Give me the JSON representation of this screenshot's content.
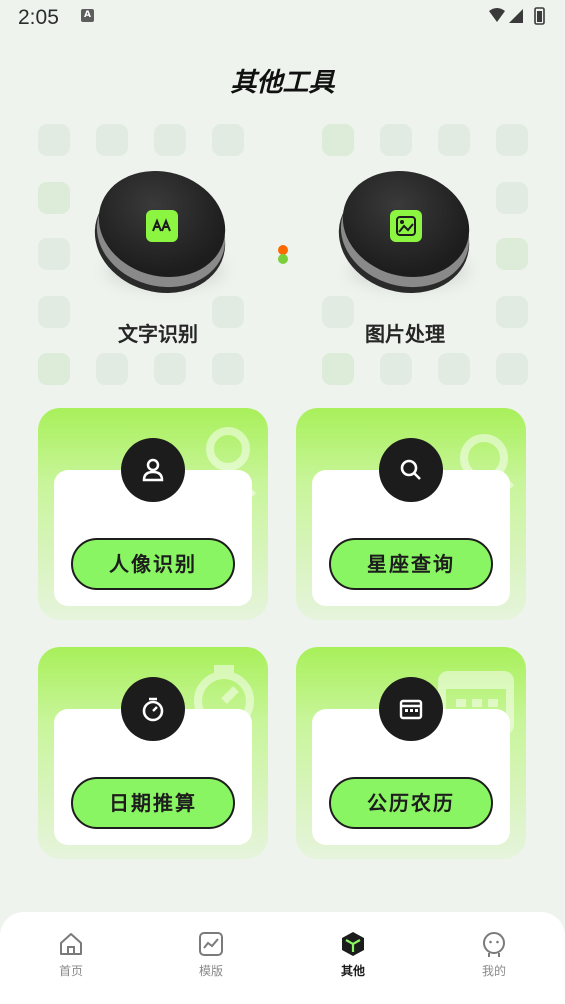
{
  "status_bar": {
    "time": "2:05",
    "notification_letter": "A"
  },
  "page_title": "其他工具",
  "features": [
    {
      "label": "文字识别",
      "icon": "text-recognition-icon"
    },
    {
      "label": "图片处理",
      "icon": "image-process-icon"
    }
  ],
  "cards": [
    {
      "label": "人像识别",
      "icon": "person-icon"
    },
    {
      "label": "星座查询",
      "icon": "search-icon"
    },
    {
      "label": "日期推算",
      "icon": "stopwatch-icon"
    },
    {
      "label": "公历农历",
      "icon": "calendar-icon"
    }
  ],
  "bottom_nav": [
    {
      "label": "首页",
      "icon": "home-icon"
    },
    {
      "label": "模版",
      "icon": "chart-icon"
    },
    {
      "label": "其他",
      "icon": "cube-icon",
      "active": true
    },
    {
      "label": "我的",
      "icon": "profile-face-icon"
    }
  ],
  "colors": {
    "accent": "#8af563",
    "dot_orange": "#ff6a00",
    "dot_green": "#7ad03a"
  }
}
